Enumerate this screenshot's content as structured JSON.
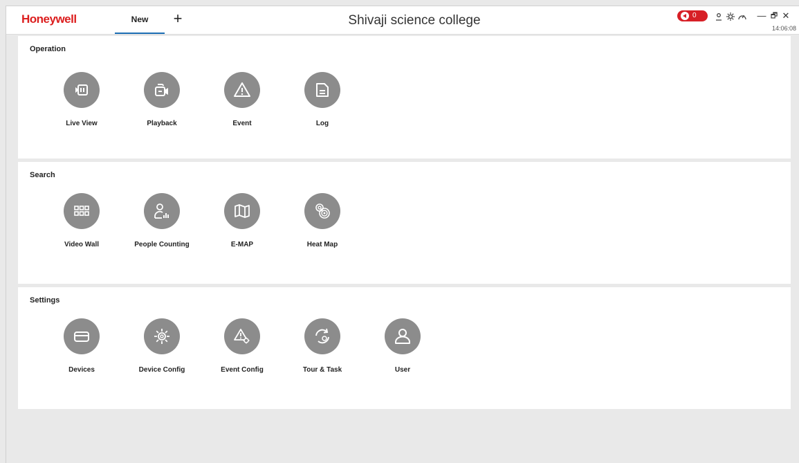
{
  "header": {
    "brand": "Honeywell",
    "tab_label": "New",
    "add_tab_glyph": "+",
    "site_name": "Shivaji science college",
    "alarm_count": "0",
    "clock": "14:06:08",
    "window_controls": {
      "minimize": "—",
      "restore": "🗗",
      "close": "✕"
    }
  },
  "sections": [
    {
      "title": "Operation",
      "items": [
        {
          "label": "Live View",
          "icon": "live-view-icon"
        },
        {
          "label": "Playback",
          "icon": "playback-icon"
        },
        {
          "label": "Event",
          "icon": "event-warning-icon"
        },
        {
          "label": "Log",
          "icon": "log-icon"
        }
      ]
    },
    {
      "title": "Search",
      "items": [
        {
          "label": "Video Wall",
          "icon": "video-wall-icon"
        },
        {
          "label": "People Counting",
          "icon": "people-counting-icon"
        },
        {
          "label": "E-MAP",
          "icon": "map-icon"
        },
        {
          "label": "Heat Map",
          "icon": "heat-map-icon"
        }
      ]
    },
    {
      "title": "Settings",
      "items": [
        {
          "label": "Devices",
          "icon": "devices-icon"
        },
        {
          "label": "Device Config",
          "icon": "gear-icon"
        },
        {
          "label": "Event Config",
          "icon": "event-config-icon"
        },
        {
          "label": "Tour & Task",
          "icon": "tour-task-icon"
        },
        {
          "label": "User",
          "icon": "user-icon"
        }
      ]
    }
  ],
  "colors": {
    "brand": "#dc1e1e",
    "tab_underline": "#1d6fb5",
    "tile_circle": "#8c8c8c",
    "alarm": "#d71f26"
  }
}
